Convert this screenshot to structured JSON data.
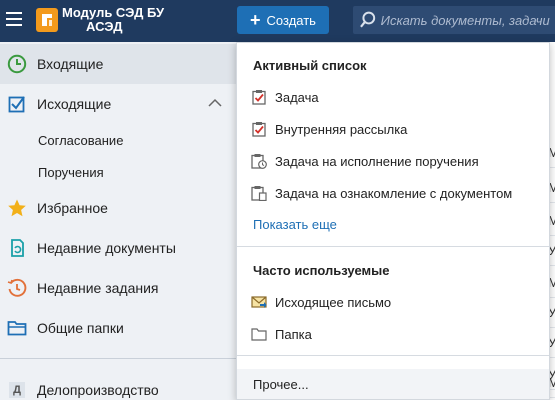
{
  "app": {
    "title_line1": "Модуль СЭД БУ",
    "title_line2": "АСЭД",
    "logo_icon": "app-logo-icon",
    "brand_color": "#1f3a5f",
    "accent_color": "#1e6fb5",
    "logo_color": "#f39a1c"
  },
  "header": {
    "create_label": "Создать",
    "search_placeholder": "Искать документы, задачи"
  },
  "sidebar": {
    "items": [
      {
        "label": "Входящие",
        "icon": "clock-icon"
      },
      {
        "label": "Исходящие",
        "icon": "checkbox-icon"
      },
      {
        "label": "Избранное",
        "icon": "star-icon"
      },
      {
        "label": "Недавние документы",
        "icon": "recent-docs-icon"
      },
      {
        "label": "Недавние задания",
        "icon": "recent-tasks-icon"
      },
      {
        "label": "Общие папки",
        "icon": "folder-icon"
      },
      {
        "label": "Делопроизводство",
        "icon": "letter-d-icon",
        "badge": "Д"
      }
    ],
    "subitems": [
      {
        "label": "Согласование"
      },
      {
        "label": "Поручения"
      }
    ]
  },
  "dropdown": {
    "active_header": "Активный список",
    "active_items": [
      {
        "label": "Задача",
        "icon": "task-icon"
      },
      {
        "label": "Внутренняя рассылка",
        "icon": "task-icon"
      },
      {
        "label": "Задача на исполнение поручения",
        "icon": "task-clock-icon"
      },
      {
        "label": "Задача на ознакомление с документом",
        "icon": "task-doc-icon"
      }
    ],
    "show_more": "Показать еще",
    "frequent_header": "Часто используемые",
    "frequent_items": [
      {
        "label": "Исходящее письмо",
        "icon": "envelope-icon"
      },
      {
        "label": "Папка",
        "icon": "folder-outline-icon"
      }
    ],
    "other": "Прочее..."
  },
  "bg_letters": [
    "М",
    "М",
    "М",
    "У",
    "М",
    "У",
    "У",
    "У",
    "М",
    "М"
  ]
}
